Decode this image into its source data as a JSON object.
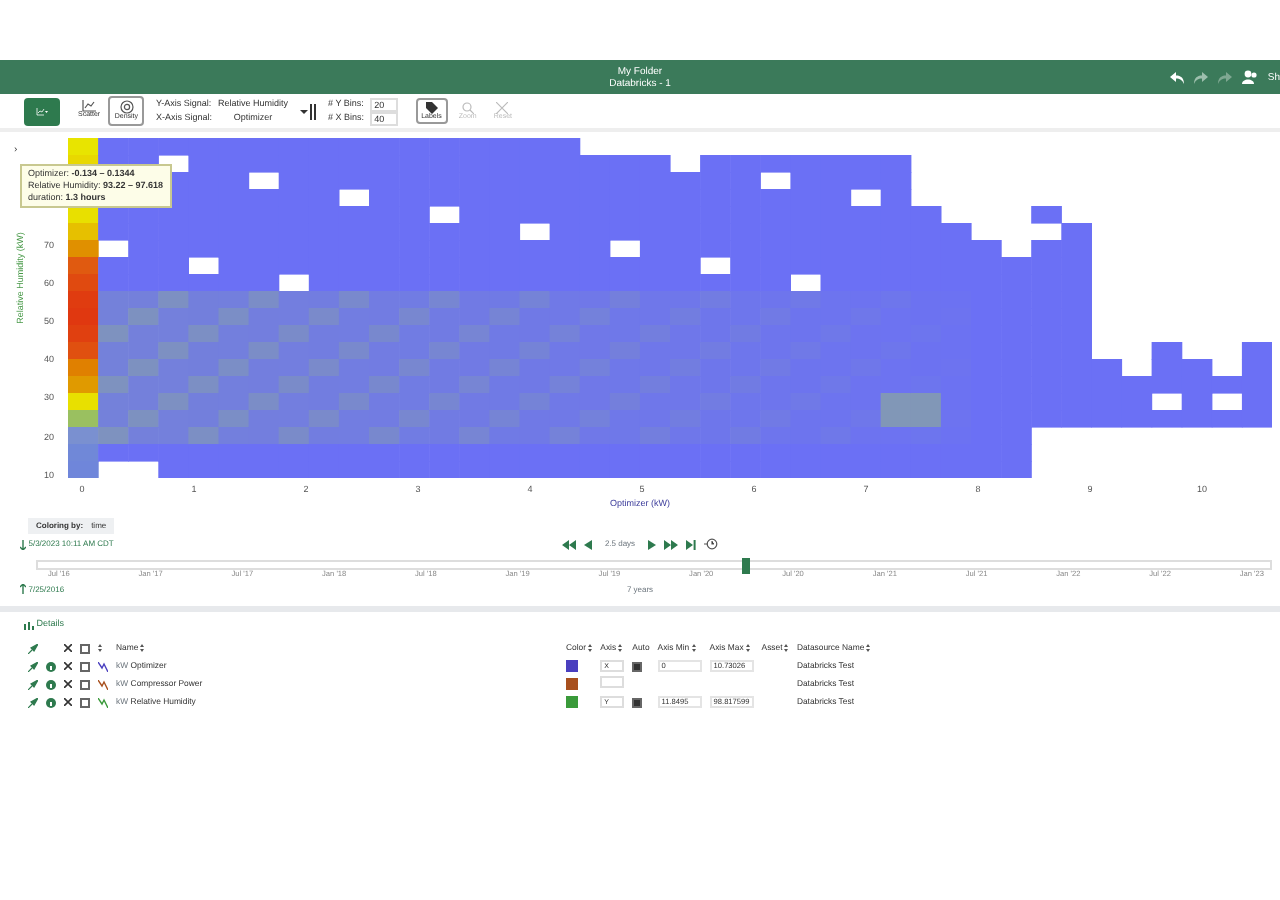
{
  "header": {
    "folder": "My Folder",
    "title": "Databricks - 1",
    "share_label": "Sh"
  },
  "toolbar": {
    "chart_types": [
      {
        "label": "Scatter",
        "selected": false
      },
      {
        "label": "Density",
        "selected": true
      }
    ],
    "y_signal_label": "Y-Axis Signal:",
    "y_signal": "Relative Humidity",
    "x_signal_label": "X-Axis Signal:",
    "x_signal": "Optimizer",
    "y_bins_label": "# Y Bins:",
    "y_bins": "20",
    "x_bins_label": "# X Bins:",
    "x_bins": "40",
    "tools": [
      {
        "label": "Labels",
        "disabled": false
      },
      {
        "label": "Zoom",
        "disabled": true
      },
      {
        "label": "Reset",
        "disabled": true
      }
    ]
  },
  "chart": {
    "expand_glyph": "›",
    "ylabel": "Relative Humidity (kW)",
    "xlabel": "Optimizer (kW)",
    "yticks": [
      "70",
      "60",
      "50",
      "40",
      "30",
      "20",
      "10"
    ],
    "xticks": [
      "0",
      "1",
      "2",
      "3",
      "4",
      "5",
      "6",
      "7",
      "8",
      "9",
      "10"
    ],
    "tooltip": [
      {
        "label": "Optimizer:",
        "value": "-0.134 – 0.1344"
      },
      {
        "label": "Relative Humidity:",
        "value": "93.22 – 97.618"
      },
      {
        "label": "duration:",
        "value": "1.3 hours"
      }
    ]
  },
  "coloring": {
    "label": "Coloring by:",
    "value": "time"
  },
  "timeline": {
    "end": "5/3/2023 10:11 AM CDT",
    "step": "2.5 days",
    "start": "7/25/2016",
    "span": "7 years",
    "ticks": [
      "Jul '16",
      "Jan '17",
      "Jul '17",
      "Jan '18",
      "Jul '18",
      "Jan '19",
      "Jul '19",
      "Jan '20",
      "Jul '20",
      "Jan '21",
      "Jul '21",
      "Jan '22",
      "Jul '22",
      "Jan '23"
    ]
  },
  "details": {
    "title": "Details",
    "all_selected": false,
    "columns": [
      "Name",
      "Color",
      "Axis",
      "Auto",
      "Axis Min",
      "Axis Max",
      "Asset",
      "Datasource Name"
    ],
    "rows": [
      {
        "unit": "kW",
        "name": "Optimizer",
        "selected": false,
        "color": "#4a3fbf",
        "axis": "X",
        "auto": true,
        "axis_min": "0",
        "axis_max": "10.73026",
        "datasource": "Databricks Test"
      },
      {
        "unit": "kW",
        "name": "Compressor Power",
        "selected": false,
        "color": "#a8501e",
        "datasource": "Databricks Test"
      },
      {
        "unit": "kW",
        "name": "Relative Humidity",
        "selected": false,
        "color": "#3a9a3a",
        "axis": "Y",
        "auto": true,
        "axis_min": "11.8495",
        "axis_max": "98.817599",
        "datasource": "Databricks Test"
      }
    ]
  }
}
